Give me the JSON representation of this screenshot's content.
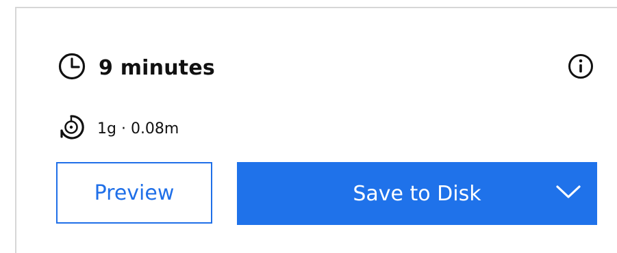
{
  "summary": {
    "time_label": "9 minutes",
    "material_label": "1g · 0.08m"
  },
  "icons": {
    "clock": "clock-icon",
    "info": "info-icon",
    "filament": "filament-spool-icon",
    "dropdown": "chevron-down-icon"
  },
  "actions": {
    "preview_label": "Preview",
    "save_label": "Save to Disk"
  },
  "colors": {
    "accent": "#1f72ea",
    "text": "#111111",
    "border": "#d6d6d6"
  }
}
